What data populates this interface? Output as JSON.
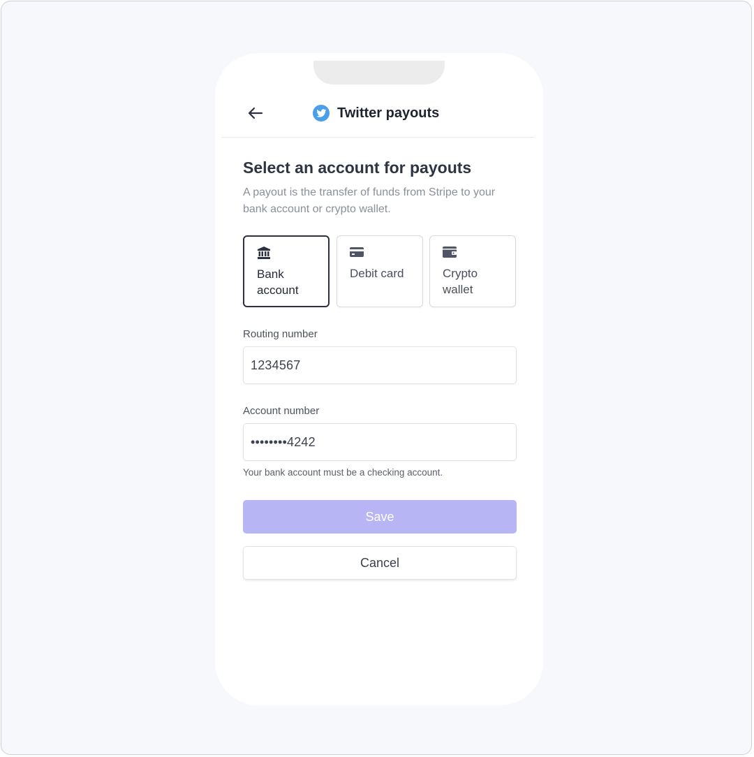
{
  "header": {
    "title": "Twitter payouts",
    "back_icon": "arrow-left-icon",
    "brand_icon": "twitter-bird-icon",
    "brand_color": "#4a9eea"
  },
  "main": {
    "heading": "Select an account for payouts",
    "description": "A payout is the transfer of funds from Stripe to your bank account or crypto wallet.",
    "payout_types": [
      {
        "label": "Bank account",
        "icon": "bank-icon",
        "selected": true
      },
      {
        "label": "Debit card",
        "icon": "credit-card-icon",
        "selected": false
      },
      {
        "label": "Crypto wallet",
        "icon": "wallet-icon",
        "selected": false
      }
    ],
    "routing": {
      "label": "Routing number",
      "value": "1234567"
    },
    "account": {
      "label": "Account number",
      "value": "••••••••4242",
      "help": "Your bank account must be a checking account."
    },
    "actions": {
      "save_label": "Save",
      "cancel_label": "Cancel",
      "save_color": "#b7b5f4"
    }
  }
}
